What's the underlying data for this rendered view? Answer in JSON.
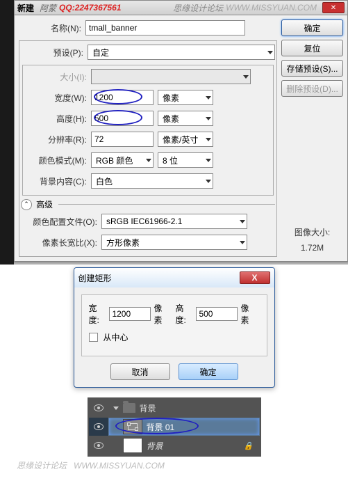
{
  "topDialog": {
    "title1": "新建",
    "title2": "阿蒙",
    "qq": "QQ:2247367561",
    "rightText": "思缘设计论坛",
    "watermarkUrl": "WWW.MISSYUAN.COM",
    "labels": {
      "name": "名称(N):",
      "preset": "预设(P):",
      "size": "大小(I):",
      "width": "宽度(W):",
      "height": "高度(H):",
      "resolution": "分辨率(R):",
      "colorMode": "颜色模式(M):",
      "bgContent": "背景内容(C):",
      "advanced": "高级",
      "colorProfile": "颜色配置文件(O):",
      "pixelAspect": "像素长宽比(X):"
    },
    "values": {
      "name": "tmall_banner",
      "preset": "自定",
      "width": "1200",
      "height": "500",
      "resolution": "72",
      "colorMode": "RGB 颜色",
      "bits": "8 位",
      "bgContent": "白色",
      "colorProfile": "sRGB IEC61966-2.1",
      "pixelAspect": "方形像素"
    },
    "units": {
      "px": "像素",
      "resUnit": "像素/英寸"
    },
    "buttons": {
      "ok": "确定",
      "reset": "复位",
      "savePreset": "存储预设(S)...",
      "deletePreset": "删除预设(D)..."
    },
    "imageSizeLabel": "图像大小:",
    "imageSizeValue": "1.72M"
  },
  "rectDialog": {
    "title": "创建矩形",
    "widthLabel": "宽度:",
    "widthValue": "1200",
    "heightLabel": "高度:",
    "heightValue": "500",
    "unit": "像素",
    "fromCenter": "从中心",
    "cancel": "取消",
    "ok": "确定"
  },
  "layers": {
    "group": "背景",
    "layer1": "背景 01",
    "bgLayer": "背景"
  },
  "bottomWatermark": "思缘设计论坛",
  "bottomUrl": "WWW.MISSYUAN.COM"
}
